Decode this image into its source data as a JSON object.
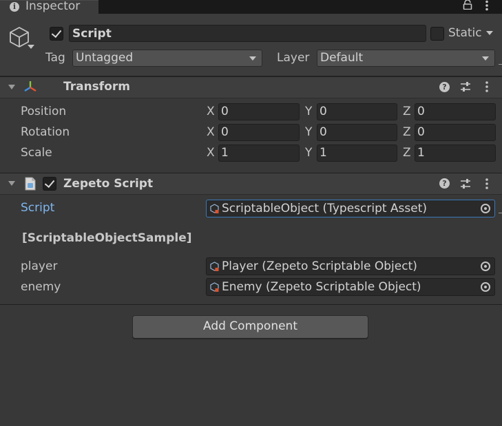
{
  "tab": {
    "title": "Inspector",
    "info_glyph": "i"
  },
  "gameobject": {
    "active": true,
    "name": "Script",
    "static_label": "Static",
    "static": false,
    "tag_label": "Tag",
    "tag_value": "Untagged",
    "layer_label": "Layer",
    "layer_value": "Default"
  },
  "transform": {
    "title": "Transform",
    "help_glyph": "?",
    "rows": [
      {
        "label": "Position",
        "x": "0",
        "y": "0",
        "z": "0"
      },
      {
        "label": "Rotation",
        "x": "0",
        "y": "0",
        "z": "0"
      },
      {
        "label": "Scale",
        "x": "1",
        "y": "1",
        "z": "1"
      }
    ],
    "axis_x": "X",
    "axis_y": "Y",
    "axis_z": "Z"
  },
  "zepeto_script": {
    "title": "Zepeto Script",
    "enabled": true,
    "help_glyph": "?",
    "script_label": "Script",
    "script_value": "ScriptableObject (Typescript Asset)",
    "section_header": "[ScriptableObjectSample]",
    "fields": [
      {
        "label": "player",
        "value": "Player (Zepeto Scriptable Object)"
      },
      {
        "label": "enemy",
        "value": "Enemy (Zepeto Scriptable Object)"
      }
    ]
  },
  "add_component_label": "Add Component",
  "colors": {
    "background": "#383838",
    "header": "#3c3c3c",
    "field": "#2a2a2a",
    "focus_border": "#3a79bb",
    "script_label": "#7eb6f0",
    "transform_icon_x": "#e6512f",
    "transform_icon_y": "#8cc63f",
    "transform_icon_z": "#3f8fe6"
  }
}
